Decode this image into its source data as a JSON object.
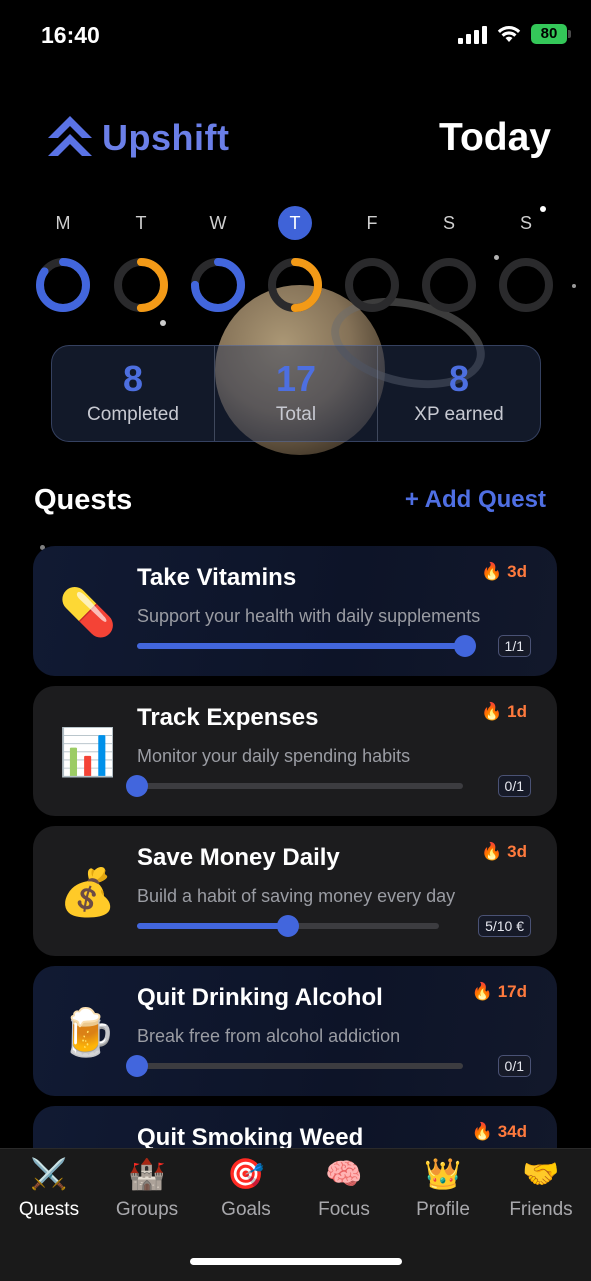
{
  "status_bar": {
    "time": "16:40",
    "battery": "80"
  },
  "header": {
    "brand": "Upshift",
    "title": "Today"
  },
  "week": [
    {
      "letter": "M",
      "progress": 0.85,
      "color": "#4266dd",
      "active": false
    },
    {
      "letter": "T",
      "progress": 0.5,
      "color": "#f39a17",
      "active": false
    },
    {
      "letter": "W",
      "progress": 0.75,
      "color": "#4266dd",
      "active": false
    },
    {
      "letter": "T",
      "progress": 0.5,
      "color": "#f39a17",
      "active": true
    },
    {
      "letter": "F",
      "progress": 0,
      "color": "#4266dd",
      "active": false
    },
    {
      "letter": "S",
      "progress": 0,
      "color": "#4266dd",
      "active": false
    },
    {
      "letter": "S",
      "progress": 0,
      "color": "#4266dd",
      "active": false
    }
  ],
  "stats": [
    {
      "value": "8",
      "label": "Completed"
    },
    {
      "value": "17",
      "label": "Total"
    },
    {
      "value": "8",
      "label": "XP earned"
    }
  ],
  "quests_section": {
    "title": "Quests",
    "add_label": "+ Add Quest"
  },
  "quests": [
    {
      "emoji": "💊",
      "title": "Take Vitamins",
      "desc": "Support your health with daily supplements",
      "streak": "🔥 3d",
      "count": "1/1",
      "progress": 1.0,
      "highlight": true
    },
    {
      "emoji": "📊",
      "title": "Track Expenses",
      "desc": "Monitor your daily spending habits",
      "streak": "🔥 1d",
      "count": "0/1",
      "progress": 0,
      "highlight": false
    },
    {
      "emoji": "💰",
      "title": "Save Money Daily",
      "desc": "Build a habit of saving money every day",
      "streak": "🔥 3d",
      "count": "5/10 €",
      "progress": 0.5,
      "highlight": false
    },
    {
      "emoji": "🍺",
      "title": "Quit Drinking Alcohol",
      "desc": "Break free from alcohol addiction",
      "streak": "🔥 17d",
      "count": "0/1",
      "progress": 0,
      "highlight": true
    },
    {
      "emoji": "",
      "title": "Quit Smoking Weed",
      "desc": "",
      "streak": "🔥 34d",
      "count": "",
      "progress": 0,
      "highlight": true
    }
  ],
  "tabs": [
    {
      "icon": "⚔️",
      "icon_name": "crossed-swords-icon",
      "label": "Quests",
      "active": true
    },
    {
      "icon": "🏰",
      "icon_name": "castle-icon",
      "label": "Groups",
      "active": false
    },
    {
      "icon": "🎯",
      "icon_name": "target-icon",
      "label": "Goals",
      "active": false
    },
    {
      "icon": "🧠",
      "icon_name": "brain-icon",
      "label": "Focus",
      "active": false
    },
    {
      "icon": "👑",
      "icon_name": "crown-icon",
      "label": "Profile",
      "active": false
    },
    {
      "icon": "🤝",
      "icon_name": "handshake-icon",
      "label": "Friends",
      "active": false
    }
  ]
}
